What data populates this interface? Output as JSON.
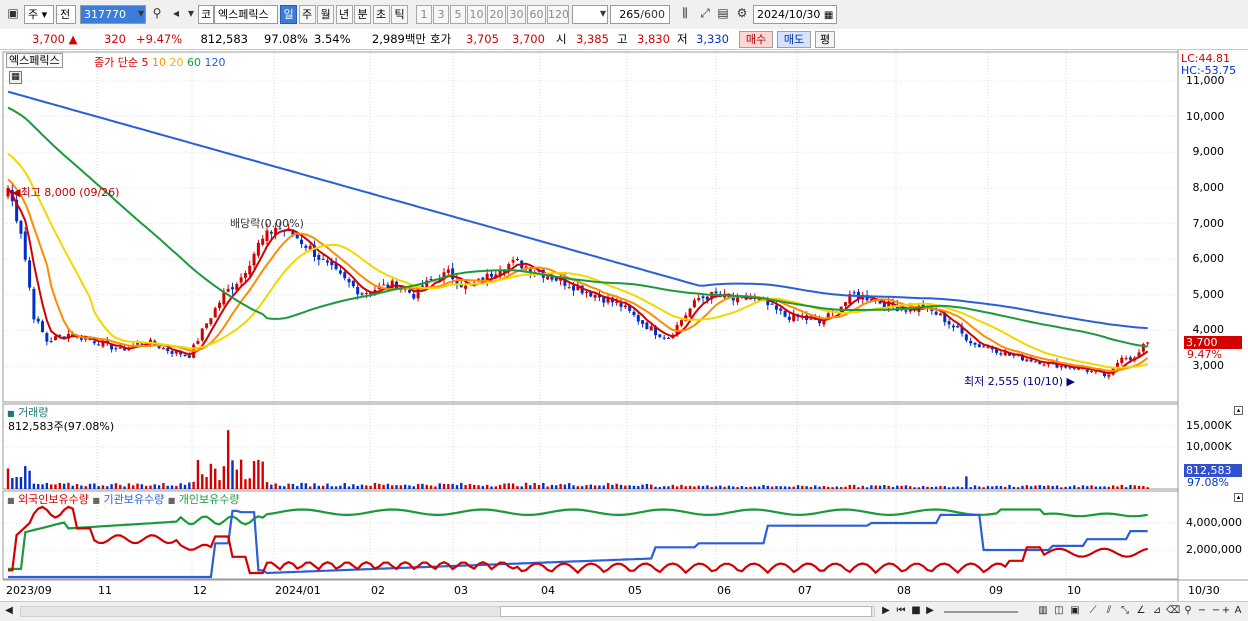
{
  "toolbar": {
    "market": "주",
    "prev_label": "전",
    "code": "317770",
    "name_prefix": "코",
    "stock_name": "엑스페릭스",
    "periods": [
      "일",
      "주",
      "월",
      "년",
      "분",
      "초",
      "틱"
    ],
    "active_period": "일",
    "multipliers": [
      "1",
      "3",
      "5",
      "10",
      "20",
      "30",
      "60",
      "120"
    ],
    "count": "265",
    "count_max": "/600",
    "date": "2024/10/30"
  },
  "quote": {
    "price": "3,700",
    "change": "320",
    "change_pct": "+9.47%",
    "volume": "812,583",
    "vol_ratio": "97.08%",
    "turnover": "3.54%",
    "amount": "2,989백만",
    "ask_label": "호가",
    "ask": "3,705",
    "bid": "3,700",
    "open_label": "시",
    "open": "3,385",
    "high_label": "고",
    "high": "3,830",
    "low_label": "저",
    "low": "3,330",
    "buy": "매수",
    "sell": "매도",
    "extra": "평"
  },
  "price_panel": {
    "stock_tag": "엑스페릭스",
    "ma_title": "종가 단순",
    "ma_periods": [
      "5",
      "10",
      "20",
      "60",
      "120"
    ],
    "ma_colors": [
      "#d40000",
      "#ff8c00",
      "#f0d800",
      "#1a9a3a",
      "#2a5fd8"
    ],
    "lc": "LC:44.81",
    "hc": "HC:-53.75",
    "high_note": "최고 8,000 (09/26)",
    "low_note": "최저 2,555 (10/10)",
    "dividend_note": "배당락(0.00%)",
    "last_price": "3,700",
    "last_pct": "9.47%",
    "y_ticks": [
      "11,000",
      "10,000",
      "9,000",
      "8,000",
      "7,000",
      "6,000",
      "5,000",
      "4,000",
      "3,000"
    ]
  },
  "volume_panel": {
    "title": "거래량",
    "value": "812,583주(97.08%)",
    "y_ticks": [
      "15,000K",
      "10,000K"
    ],
    "last": "812,583",
    "last_pct": "97.08%"
  },
  "holder_panel": {
    "series_names": [
      "외국인보유수량",
      "기관보유수량",
      "개인보유수량"
    ],
    "series_colors": [
      "#d40000",
      "#2a5fd8",
      "#1a9a3a"
    ],
    "y_ticks": [
      "4,000,000",
      "2,000,000"
    ]
  },
  "x_axis": {
    "labels": [
      "2023/09",
      "11",
      "12",
      "2024/01",
      "02",
      "03",
      "04",
      "05",
      "06",
      "07",
      "08",
      "09",
      "10"
    ],
    "end_label": "10/30"
  },
  "colors": {
    "up": "#d40000",
    "down": "#0030c8",
    "selected": "#3b7dd8"
  }
}
